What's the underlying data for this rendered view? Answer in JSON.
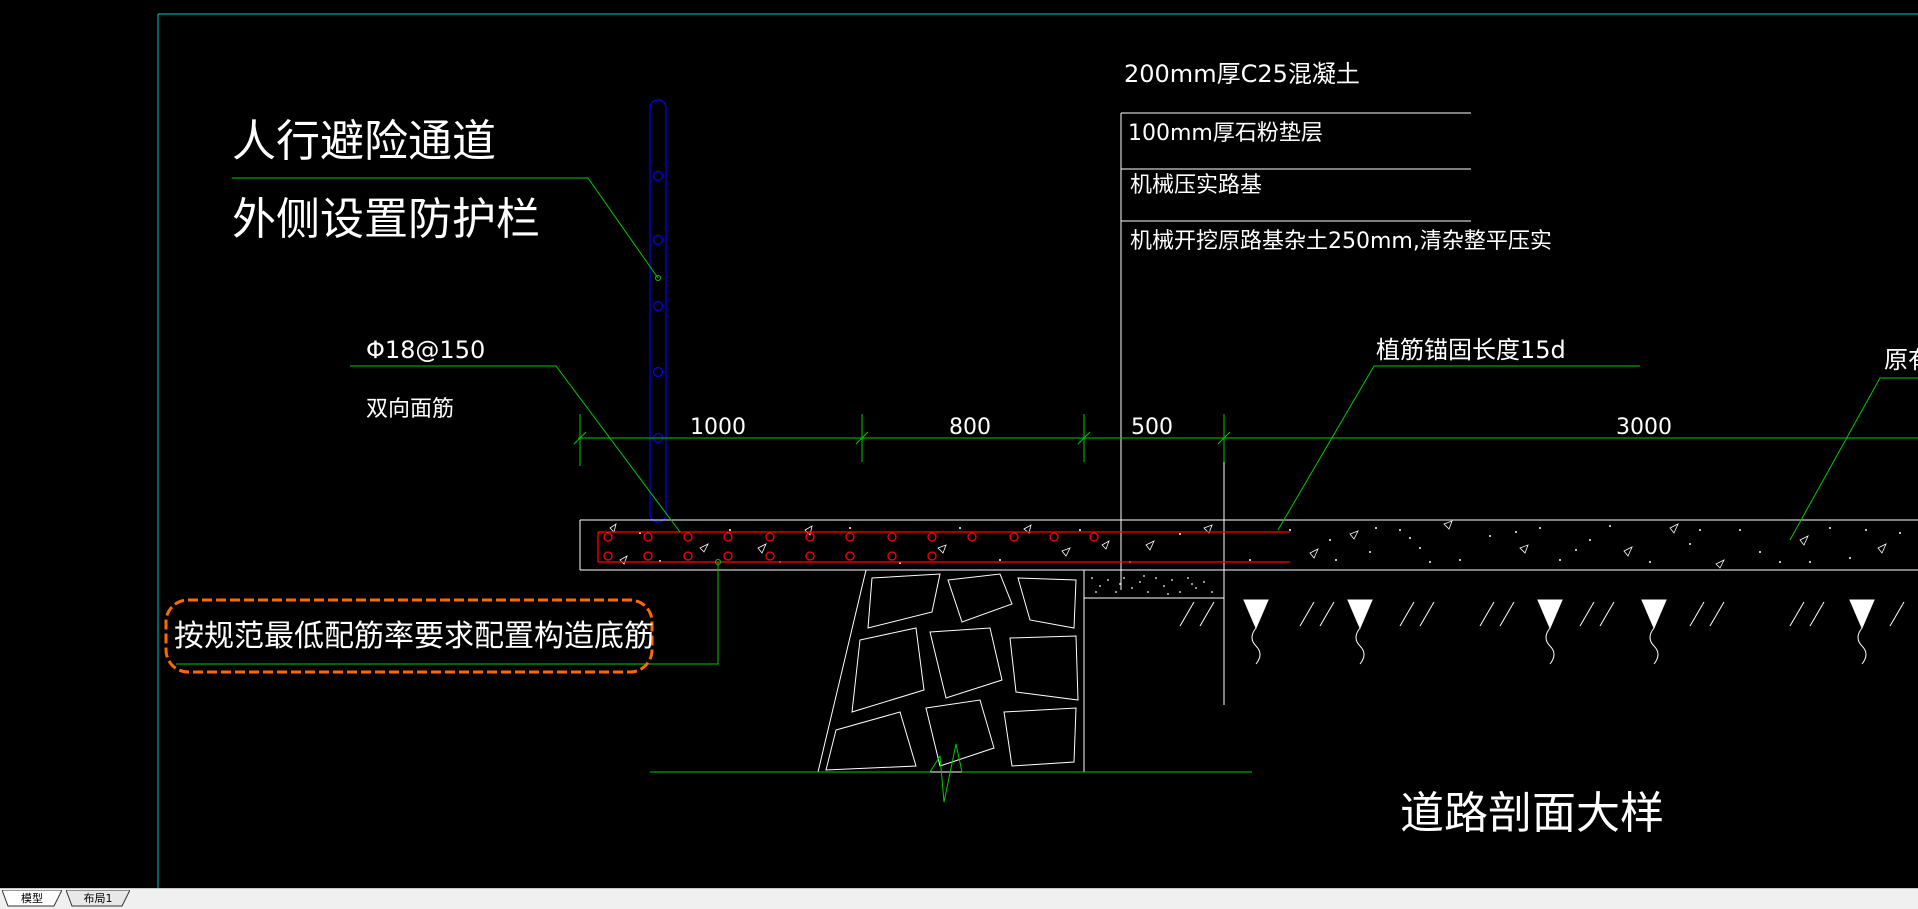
{
  "drawing": {
    "labels": {
      "walkway_line1": "人行避险通道",
      "walkway_line2": "外侧设置防护栏",
      "rebar_spec": "Φ18@150",
      "rebar_desc": "双向面筋",
      "layer_concrete": "200mm厚C25混凝土",
      "layer_gravel": "100mm厚石粉垫层",
      "layer_subgrade": "机械压实路基",
      "layer_excavate": "机械开挖原路基杂土250mm,清杂整平压实",
      "anchor_length": "植筋锚固长度15d",
      "existing_road_partial": "原有",
      "bottom_rebar_note": "按规范最低配筋率要求配置构造底筋",
      "section_title": "道路剖面大样"
    },
    "dimensions": [
      "1000",
      "800",
      "500",
      "3000"
    ],
    "colors": {
      "background": "#000000",
      "frame": "#00c8c8",
      "leader": "#00c800",
      "dimension": "#00c800",
      "rebar": "#ff0000",
      "railing": "#0000ff",
      "revision_cloud": "#ff6a00",
      "line": "#ffffff"
    }
  },
  "tabs": [
    {
      "label": "模型",
      "active": true
    },
    {
      "label": "布局1",
      "active": false
    }
  ]
}
